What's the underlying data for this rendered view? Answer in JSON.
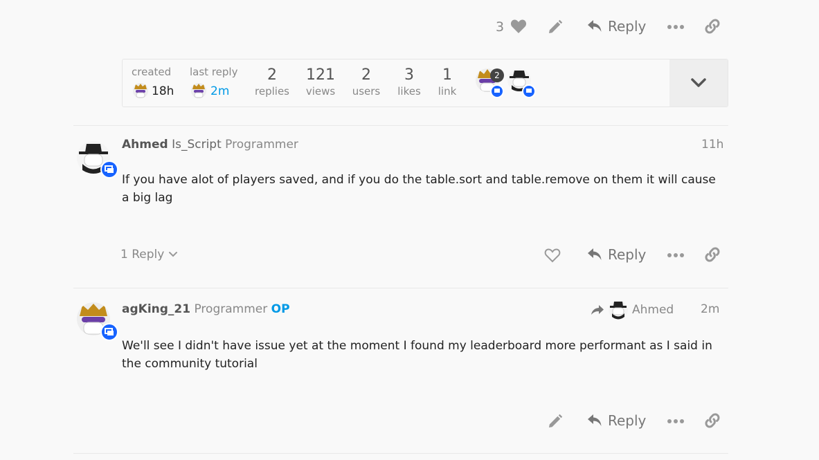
{
  "top_actions": {
    "like_count": "3",
    "reply_label": "Reply"
  },
  "topic_map": {
    "created_label": "created",
    "created_value": "18h",
    "last_reply_label": "last reply",
    "last_reply_value": "2m",
    "stats": [
      {
        "number": "2",
        "label": "replies"
      },
      {
        "number": "121",
        "label": "views"
      },
      {
        "number": "2",
        "label": "users"
      },
      {
        "number": "3",
        "label": "likes"
      },
      {
        "number": "1",
        "label": "link"
      }
    ],
    "participant_count": "2"
  },
  "posts": [
    {
      "username": "Ahmed",
      "full_name": "Is_Script",
      "user_title": "Programmer",
      "time": "11h",
      "body": "If you have alot of players saved, and if you do the table.sort and table.remove on them it will cause a big lag",
      "replies_label": "1 Reply",
      "reply_label": "Reply"
    },
    {
      "username": "agKing_21",
      "user_title": "Programmer",
      "op_label": "OP",
      "reply_to": "Ahmed",
      "time": "2m",
      "body": "We'll see I didn't have issue yet at the moment I found my leaderboard more performant as I said in the community tutorial",
      "reply_label": "Reply"
    }
  ],
  "colors": {
    "accent": "#0099e6",
    "badge": "#1763ff",
    "muted": "#888888"
  }
}
